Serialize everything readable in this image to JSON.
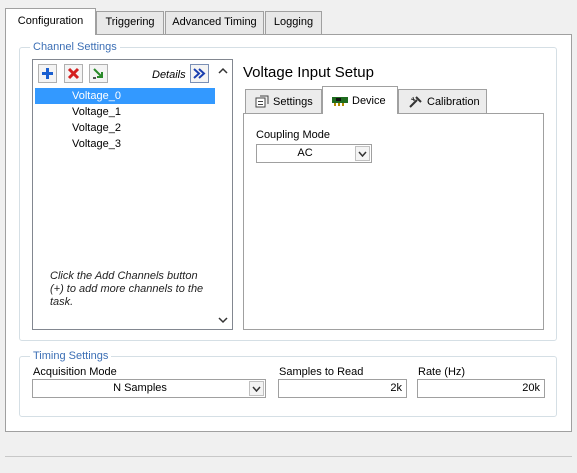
{
  "outer_tabs": [
    {
      "label": "Configuration",
      "active": true
    },
    {
      "label": "Triggering"
    },
    {
      "label": "Advanced Timing"
    },
    {
      "label": "Logging"
    }
  ],
  "channel_settings": {
    "title": "Channel Settings",
    "details_label": "Details",
    "channels": [
      "Voltage_0",
      "Voltage_1",
      "Voltage_2",
      "Voltage_3"
    ],
    "selected_index": 0,
    "hint": "Click the Add Channels button (+) to add more channels to the task."
  },
  "setup": {
    "title": "Voltage Input Setup",
    "tabs": [
      {
        "label": "Settings",
        "icon": "settings-icon"
      },
      {
        "label": "Device",
        "icon": "device-icon",
        "active": true
      },
      {
        "label": "Calibration",
        "icon": "calibration-icon"
      }
    ],
    "coupling_mode_label": "Coupling Mode",
    "coupling_mode_value": "AC"
  },
  "timing_settings": {
    "title": "Timing Settings",
    "acquisition_mode_label": "Acquisition Mode",
    "acquisition_mode_value": "N Samples",
    "samples_label": "Samples to Read",
    "samples_value": "2k",
    "rate_label": "Rate (Hz)",
    "rate_value": "20k"
  },
  "colors": {
    "group_title": "#3c6fb5",
    "selection": "#3399ff",
    "add_icon": "#1a5fd0",
    "remove_icon": "#d42020"
  }
}
